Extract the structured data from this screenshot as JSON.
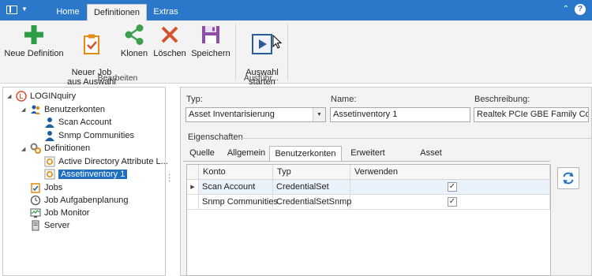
{
  "titlebar": {
    "tabs": [
      {
        "label": "Home"
      },
      {
        "label": "Definitionen"
      },
      {
        "label": "Extras"
      }
    ],
    "help_label": "?",
    "collapse_label": "⌃"
  },
  "ribbon": {
    "buttons": [
      {
        "label": "Neue Definition",
        "icon": "plus-icon",
        "color": "#2e9e45"
      },
      {
        "label": "Neuer Job\naus Auswahl",
        "icon": "clipboard-check-icon",
        "color": "#e38b14"
      },
      {
        "label": "Klonen",
        "icon": "share-icon",
        "color": "#3aa04c"
      },
      {
        "label": "Löschen",
        "icon": "close-icon",
        "color": "#d3542f"
      },
      {
        "label": "Speichern",
        "icon": "floppy-disk-icon",
        "color": "#8c4fa5"
      },
      {
        "label": "Auswahl\nstarten",
        "icon": "play-icon",
        "color": "#2b5c9a"
      }
    ],
    "groups": [
      {
        "label": "Bearbeiten"
      },
      {
        "label": "Ausführ..."
      }
    ]
  },
  "tree": {
    "items": [
      {
        "label": "LOGINquiry",
        "icon": "login-logo-icon"
      },
      {
        "label": "Benutzerkonten",
        "icon": "users-icon"
      },
      {
        "label": "Scan Account",
        "icon": "user-icon"
      },
      {
        "label": "Snmp Communities",
        "icon": "user-icon"
      },
      {
        "label": "Definitionen",
        "icon": "gears-icon"
      },
      {
        "label": "Active Directory Attribute L...",
        "icon": "gear-doc-icon"
      },
      {
        "label": "Assetinventory 1",
        "icon": "gear-doc-icon"
      },
      {
        "label": "Jobs",
        "icon": "jobs-clipboard-icon"
      },
      {
        "label": "Job Aufgabenplanung",
        "icon": "clock-icon"
      },
      {
        "label": "Job Monitor",
        "icon": "monitor-icon"
      },
      {
        "label": "Server",
        "icon": "server-icon"
      }
    ]
  },
  "form": {
    "typ_label": "Typ:",
    "typ_value": "Asset Inventarisierung",
    "name_label": "Name:",
    "name_value": "Assetinventory 1",
    "beschreibung_label": "Beschreibung:",
    "beschreibung_value": "Realtek PCIe GBE Family Contro"
  },
  "eigenschaften": {
    "title": "Eigenschaften",
    "tabs": [
      {
        "label": "Quelle"
      },
      {
        "label": "Allgemein"
      },
      {
        "label": "Benutzerkonten"
      },
      {
        "label": "Erweitert"
      },
      {
        "label": "Asset Eigenschaften"
      }
    ]
  },
  "grid": {
    "columns": [
      "Konto",
      "Typ",
      "Verwenden"
    ],
    "rows": [
      {
        "konto": "Scan Account",
        "typ": "CredentialSet",
        "verwenden": "✓"
      },
      {
        "konto": "Snmp Communities",
        "typ": "CredentialSetSnmp",
        "verwenden": "✓"
      }
    ]
  },
  "colors": {
    "accent": "#2b77c9",
    "selection": "#1e6fc2"
  }
}
